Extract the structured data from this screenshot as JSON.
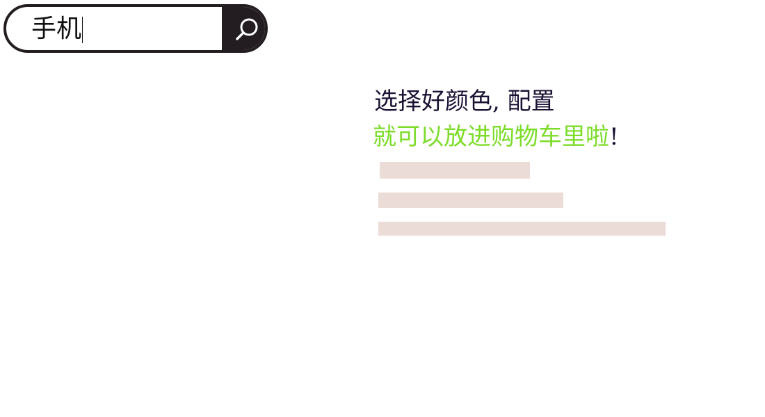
{
  "search": {
    "value": "手机",
    "button_icon": "search-icon"
  },
  "promo": {
    "line1": "选择好颜色, 配置",
    "line2_main": "就可以放进购物车里啦",
    "line2_end": "!",
    "colors": {
      "line1": "#1a1133",
      "line2": "#7ddc2a",
      "placeholder_bar": "#ecdcd7",
      "search_dark": "#231d21"
    }
  }
}
